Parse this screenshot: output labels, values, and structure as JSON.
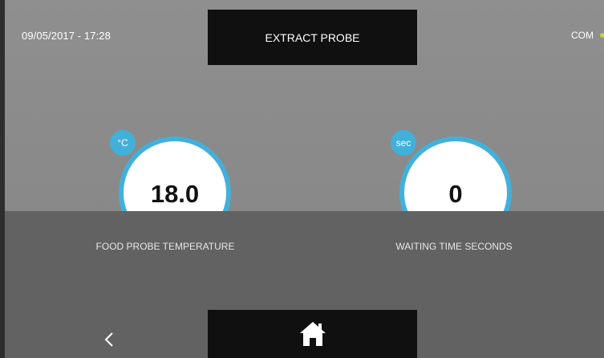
{
  "header": {
    "datetime": "09/05/2017 - 17:28",
    "title": "EXTRACT PROBE",
    "status_label": "COM",
    "status_color": "#c8d23a"
  },
  "gauges": [
    {
      "unit": "°C",
      "value": "18.0",
      "label": "FOOD PROBE TEMPERATURE"
    },
    {
      "unit": "sec",
      "value": "0",
      "label": "WAITING TIME SECONDS"
    }
  ],
  "footer": {
    "back_icon": "chevron-left-icon",
    "home_icon": "home-icon"
  },
  "colors": {
    "accent": "#43b0d9",
    "screen_bg": "#8a8a8a",
    "panel_bg": "#626262",
    "box_bg": "#101010"
  }
}
